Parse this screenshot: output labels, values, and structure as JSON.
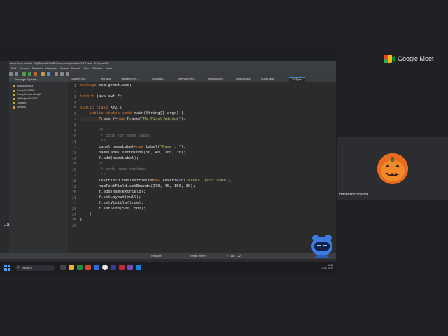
{
  "meet": {
    "brand": "Google Meet",
    "participant_name": "Himanshu Sharma"
  },
  "eclipse": {
    "window_title": "advance Java tutorial - MyProjectEtcDBC/src/com/groot/abc/XYZ.java - Eclipse IDE",
    "menu": [
      "File",
      "Edit",
      "Source",
      "Refactor",
      "Navigate",
      "Search",
      "Project",
      "Run",
      "Window",
      "Help"
    ],
    "package_explorer": {
      "title": "Package Explorer",
      "items": [
        "AbstractionEx",
        "DemoWithDBC",
        "ExceptionHandlingE",
        "MyProjectEtcDBC",
        "Onpatty",
        "Servers"
      ]
    },
    "tabs": [
      "Scanner.vb0...",
      "Test.java",
      "Validator.ben...",
      "Initializati...",
      "MethodOverl...",
      "MethodOverl...",
      "Object.class",
      "Super.java",
      "XYZ.java"
    ],
    "active_tab": "XYZ.java",
    "code_lines": [
      {
        "n": "1",
        "text": "package com.groot.abc;"
      },
      {
        "n": "2",
        "text": ""
      },
      {
        "n": "3",
        "text": "import java.awt.*;"
      },
      {
        "n": "4",
        "text": ""
      },
      {
        "n": "5",
        "text": "public class XYZ {"
      },
      {
        "n": "6",
        "text": "    public static void main(String[] args) {"
      },
      {
        "n": "7",
        "text": "        Frame f=new Frame(\"My First Window\");"
      },
      {
        "n": "8",
        "text": ""
      },
      {
        "n": "9",
        "text": "        /*"
      },
      {
        "n": "10",
        "text": "         * code for name label"
      },
      {
        "n": "11",
        "text": "         */"
      },
      {
        "n": "12",
        "text": "        Label nameLabel=new Label(\"Name : \");"
      },
      {
        "n": "13",
        "text": "        nameLabel.setBounds(50, 40, 100, 30);"
      },
      {
        "n": "14",
        "text": "        f.add(nameLabel);"
      },
      {
        "n": "15",
        "text": "        /*"
      },
      {
        "n": "16",
        "text": "         * code name textbox"
      },
      {
        "n": "17",
        "text": "         */"
      },
      {
        "n": "18",
        "text": "        TextField namTextField=new TextField(\"enter  your name\");"
      },
      {
        "n": "19",
        "text": "        namTextField.setBounds(170, 40, 150, 30);"
      },
      {
        "n": "20",
        "text": "        f.add(namTextField);"
      },
      {
        "n": "21",
        "text": "        f.setLayout(null);"
      },
      {
        "n": "22",
        "text": "        f.setVisible(true);"
      },
      {
        "n": "23",
        "text": "        f.setSize(500, 500);"
      },
      {
        "n": "24",
        "text": "    }"
      },
      {
        "n": "25",
        "text": "}"
      },
      {
        "n": "26",
        "text": ""
      }
    ],
    "status": {
      "writable": "Writable",
      "insert_mode": "Smart Insert",
      "position": "7 : 18 : 122"
    }
  },
  "taskbar": {
    "search_label": "Search",
    "time": "9:46",
    "date": "18-06-2024"
  },
  "left_peek": "Ja"
}
